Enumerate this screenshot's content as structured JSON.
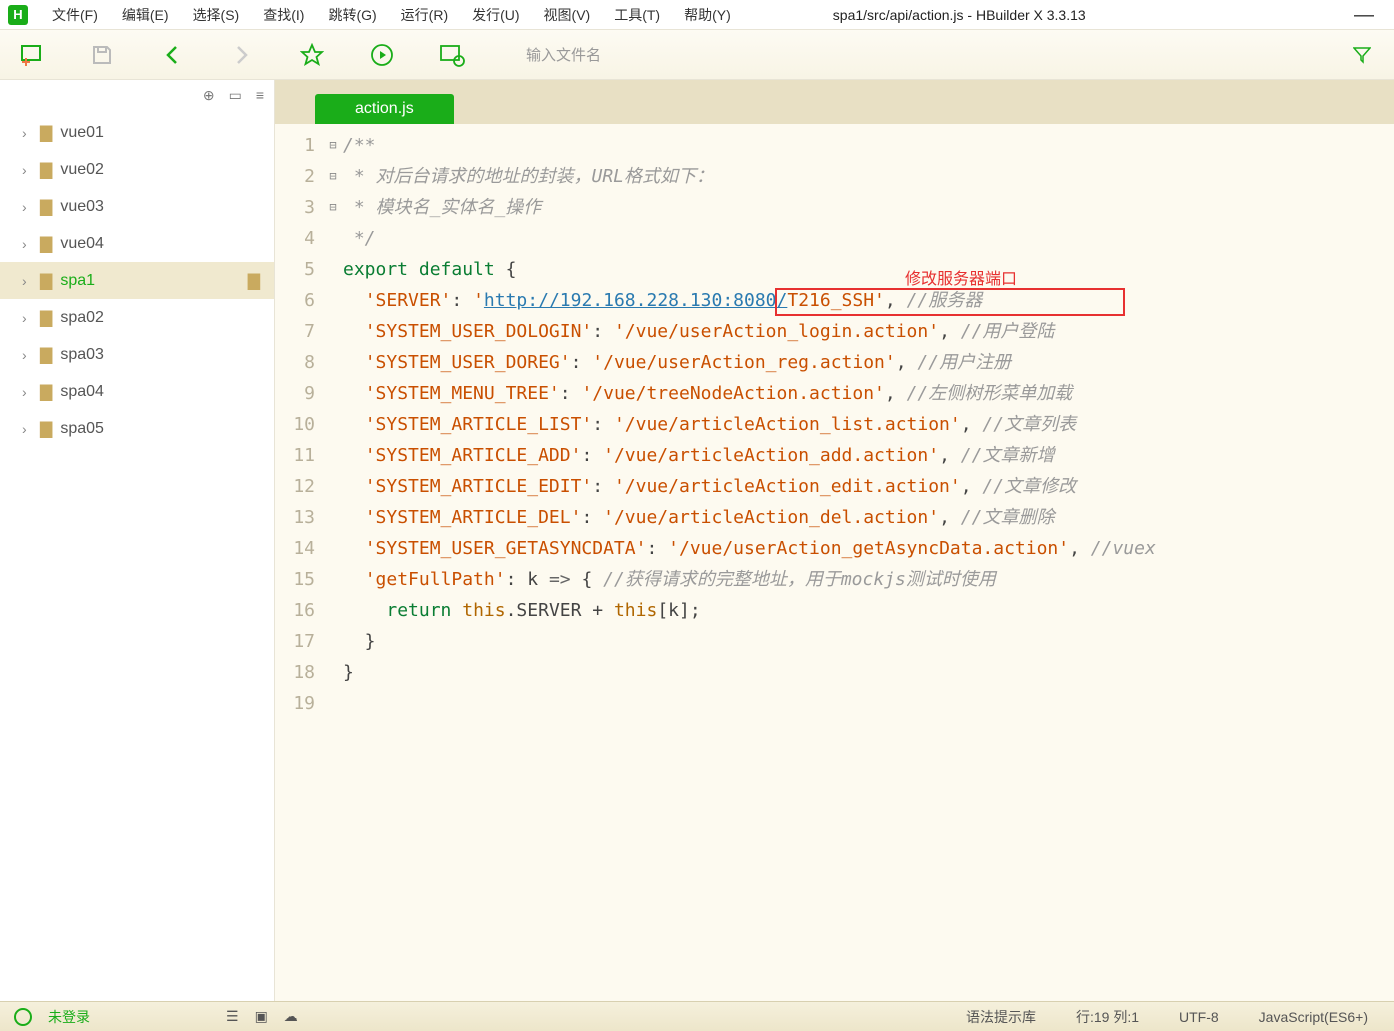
{
  "menubar": {
    "logo": "H",
    "items": [
      "文件(F)",
      "编辑(E)",
      "选择(S)",
      "查找(I)",
      "跳转(G)",
      "运行(R)",
      "发行(U)",
      "视图(V)",
      "工具(T)",
      "帮助(Y)"
    ],
    "window_title": "spa1/src/api/action.js - HBuilder X 3.3.13"
  },
  "toolbar": {
    "search_placeholder": "输入文件名"
  },
  "sidebar": {
    "items": [
      {
        "name": "vue01",
        "selected": false
      },
      {
        "name": "vue02",
        "selected": false
      },
      {
        "name": "vue03",
        "selected": false
      },
      {
        "name": "vue04",
        "selected": false
      },
      {
        "name": "spa1",
        "selected": true
      },
      {
        "name": "spa02",
        "selected": false
      },
      {
        "name": "spa03",
        "selected": false
      },
      {
        "name": "spa04",
        "selected": false
      },
      {
        "name": "spa05",
        "selected": false
      }
    ]
  },
  "editor": {
    "tab": "action.js",
    "annotation_label": "修改服务器端口",
    "lines": [
      {
        "n": 1,
        "fold": "⊟",
        "tokens": [
          {
            "t": "/**",
            "c": "cmt"
          }
        ]
      },
      {
        "n": 2,
        "tokens": [
          {
            "t": " * 对后台请求的地址的封装，URL格式如下：",
            "c": "cmt"
          }
        ]
      },
      {
        "n": 3,
        "tokens": [
          {
            "t": " * 模块名_实体名_操作",
            "c": "cmt"
          }
        ]
      },
      {
        "n": 4,
        "tokens": [
          {
            "t": " */",
            "c": "cmt"
          }
        ]
      },
      {
        "n": 5,
        "fold": "⊟",
        "tokens": [
          {
            "t": "export",
            "c": "kw"
          },
          {
            "t": " "
          },
          {
            "t": "default",
            "c": "kw"
          },
          {
            "t": " {"
          }
        ]
      },
      {
        "n": 6,
        "tokens": [
          {
            "t": "  "
          },
          {
            "t": "'SERVER'",
            "c": "str"
          },
          {
            "t": ": "
          },
          {
            "t": "'",
            "c": "str"
          },
          {
            "t": "http://192.168.228.130:8080/",
            "c": "str-url"
          },
          {
            "t": "T216_SSH'",
            "c": "str"
          },
          {
            "t": ", "
          },
          {
            "t": "//服务器",
            "c": "cmt"
          }
        ]
      },
      {
        "n": 7,
        "tokens": [
          {
            "t": "  "
          },
          {
            "t": "'SYSTEM_USER_DOLOGIN'",
            "c": "str"
          },
          {
            "t": ": "
          },
          {
            "t": "'/vue/userAction_login.action'",
            "c": "str"
          },
          {
            "t": ", "
          },
          {
            "t": "//用户登陆",
            "c": "cmt"
          }
        ]
      },
      {
        "n": 8,
        "tokens": [
          {
            "t": "  "
          },
          {
            "t": "'SYSTEM_USER_DOREG'",
            "c": "str"
          },
          {
            "t": ": "
          },
          {
            "t": "'/vue/userAction_reg.action'",
            "c": "str"
          },
          {
            "t": ", "
          },
          {
            "t": "//用户注册",
            "c": "cmt"
          }
        ]
      },
      {
        "n": 9,
        "tokens": [
          {
            "t": "  "
          },
          {
            "t": "'SYSTEM_MENU_TREE'",
            "c": "str"
          },
          {
            "t": ": "
          },
          {
            "t": "'/vue/treeNodeAction.action'",
            "c": "str"
          },
          {
            "t": ", "
          },
          {
            "t": "//左侧树形菜单加载",
            "c": "cmt"
          }
        ]
      },
      {
        "n": 10,
        "tokens": [
          {
            "t": "  "
          },
          {
            "t": "'SYSTEM_ARTICLE_LIST'",
            "c": "str"
          },
          {
            "t": ": "
          },
          {
            "t": "'/vue/articleAction_list.action'",
            "c": "str"
          },
          {
            "t": ", "
          },
          {
            "t": "//文章列表",
            "c": "cmt"
          }
        ]
      },
      {
        "n": 11,
        "tokens": [
          {
            "t": "  "
          },
          {
            "t": "'SYSTEM_ARTICLE_ADD'",
            "c": "str"
          },
          {
            "t": ": "
          },
          {
            "t": "'/vue/articleAction_add.action'",
            "c": "str"
          },
          {
            "t": ", "
          },
          {
            "t": "//文章新增",
            "c": "cmt"
          }
        ]
      },
      {
        "n": 12,
        "tokens": [
          {
            "t": "  "
          },
          {
            "t": "'SYSTEM_ARTICLE_EDIT'",
            "c": "str"
          },
          {
            "t": ": "
          },
          {
            "t": "'/vue/articleAction_edit.action'",
            "c": "str"
          },
          {
            "t": ", "
          },
          {
            "t": "//文章修改",
            "c": "cmt"
          }
        ]
      },
      {
        "n": 13,
        "tokens": [
          {
            "t": "  "
          },
          {
            "t": "'SYSTEM_ARTICLE_DEL'",
            "c": "str"
          },
          {
            "t": ": "
          },
          {
            "t": "'/vue/articleAction_del.action'",
            "c": "str"
          },
          {
            "t": ", "
          },
          {
            "t": "//文章删除",
            "c": "cmt"
          }
        ]
      },
      {
        "n": 14,
        "tokens": [
          {
            "t": "  "
          },
          {
            "t": "'SYSTEM_USER_GETASYNCDATA'",
            "c": "str"
          },
          {
            "t": ": "
          },
          {
            "t": "'/vue/userAction_getAsyncData.action'",
            "c": "str"
          },
          {
            "t": ", "
          },
          {
            "t": "//vuex",
            "c": "cmt"
          }
        ]
      },
      {
        "n": 15,
        "fold": "⊟",
        "tokens": [
          {
            "t": "  "
          },
          {
            "t": "'getFullPath'",
            "c": "str"
          },
          {
            "t": ": k "
          },
          {
            "t": "=>",
            "c": "punct"
          },
          {
            "t": " { "
          },
          {
            "t": "//获得请求的完整地址，用于mockjs测试时使用",
            "c": "cmt"
          }
        ]
      },
      {
        "n": 16,
        "tokens": [
          {
            "t": "    "
          },
          {
            "t": "return",
            "c": "kw"
          },
          {
            "t": " "
          },
          {
            "t": "this",
            "c": "orange"
          },
          {
            "t": ".SERVER + "
          },
          {
            "t": "this",
            "c": "orange"
          },
          {
            "t": "[k];"
          }
        ]
      },
      {
        "n": 17,
        "tokens": [
          {
            "t": "  }"
          }
        ]
      },
      {
        "n": 18,
        "fold": "",
        "tokens": [
          {
            "t": "}"
          }
        ]
      },
      {
        "n": 19,
        "tokens": [
          {
            "t": ""
          }
        ]
      }
    ]
  },
  "statusbar": {
    "login": "未登录",
    "syntax": "语法提示库",
    "pos": "行:19  列:1",
    "encoding": "UTF-8",
    "lang": "JavaScript(ES6+)"
  }
}
